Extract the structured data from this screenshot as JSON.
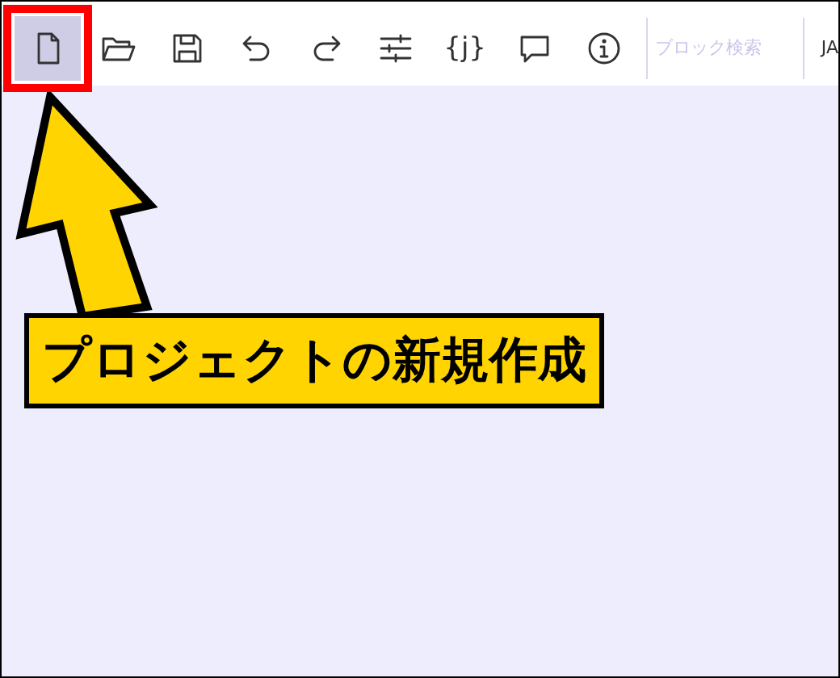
{
  "toolbar": {
    "buttons": [
      {
        "kind": "new",
        "selected": true
      },
      {
        "kind": "open",
        "selected": false
      },
      {
        "kind": "save",
        "selected": false
      },
      {
        "kind": "undo",
        "selected": false
      },
      {
        "kind": "redo",
        "selected": false
      },
      {
        "kind": "settings",
        "selected": false
      },
      {
        "kind": "json",
        "label": "{j}",
        "selected": false
      },
      {
        "kind": "comment",
        "selected": false
      },
      {
        "kind": "info",
        "selected": false
      }
    ],
    "search": {
      "placeholder": "ブロック検索"
    },
    "language": "JA"
  },
  "callout": {
    "text": "プロジェクトの新規作成"
  }
}
